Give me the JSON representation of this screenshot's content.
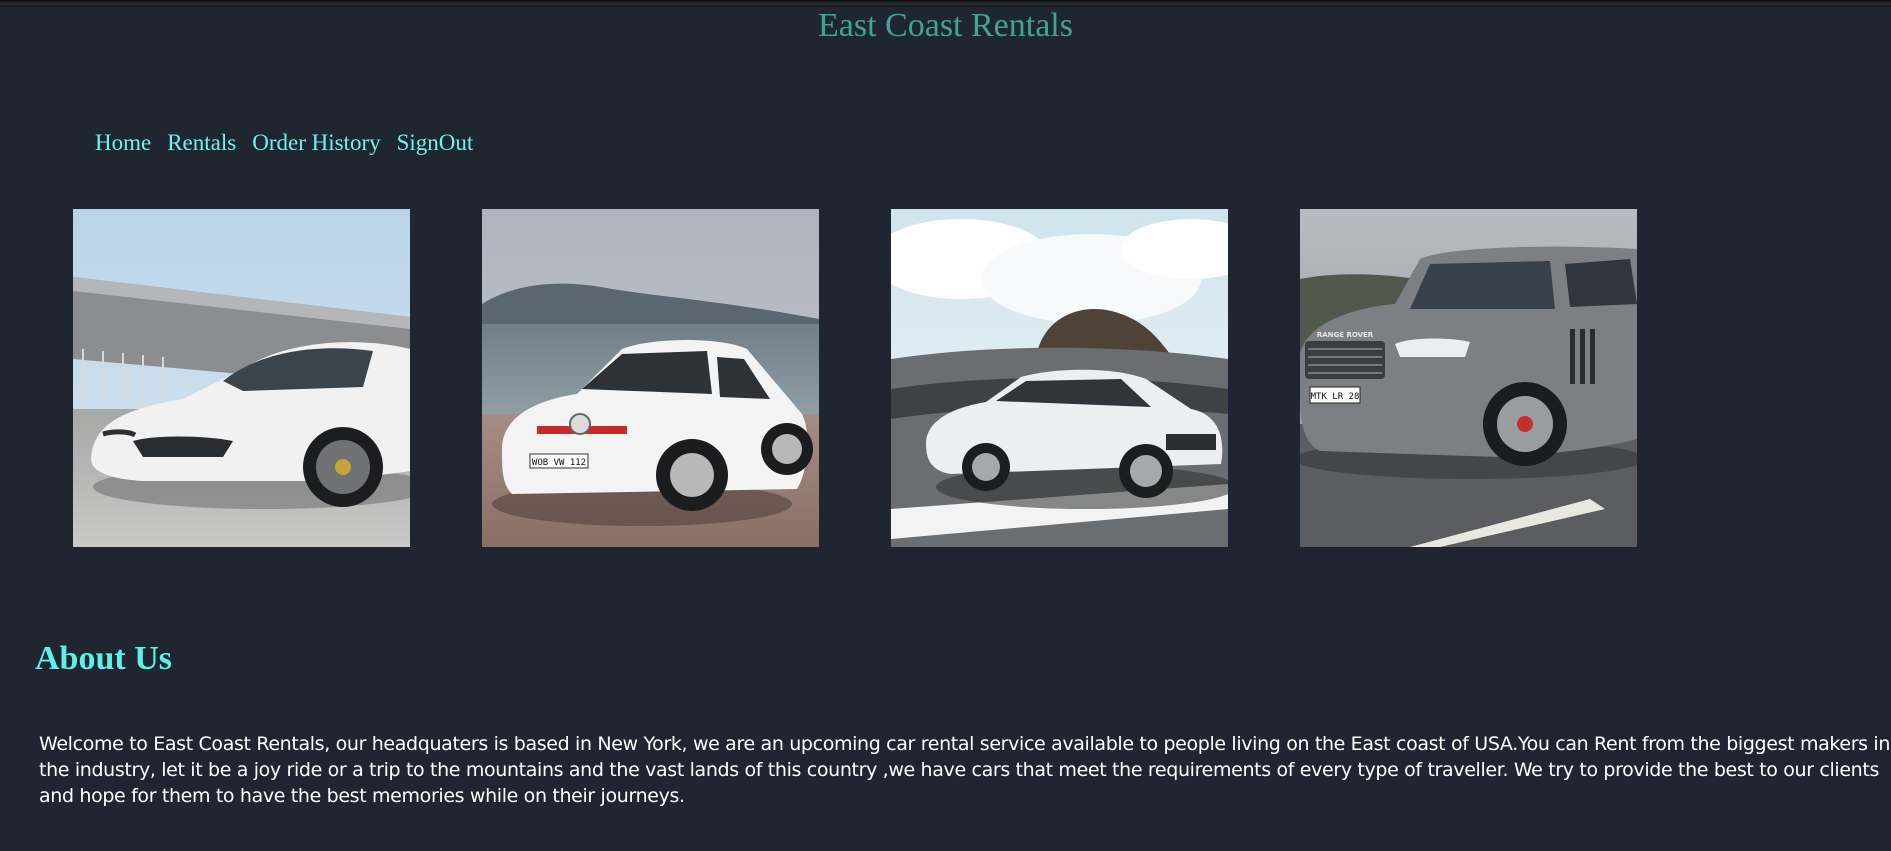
{
  "header": {
    "title": "East Coast Rentals"
  },
  "nav": {
    "items": [
      {
        "label": "Home"
      },
      {
        "label": "Rentals"
      },
      {
        "label": "Order History"
      },
      {
        "label": "SignOut"
      }
    ]
  },
  "gallery": {
    "photos": [
      {
        "subject": "white sports car",
        "plate": ""
      },
      {
        "subject": "white hatchback",
        "plate": "WOB VW 112"
      },
      {
        "subject": "white sedan",
        "plate": ""
      },
      {
        "subject": "grey suv",
        "plate": "MTK LR 28",
        "badge": "RANGE ROVER"
      }
    ]
  },
  "about": {
    "heading": "About Us",
    "body": "Welcome to East Coast Rentals, our headquaters is based in New York, we are an upcoming car rental service available to people living on the East coast of USA.You can Rent from the biggest makers in the industry, let it be a joy ride or a trip to the mountains and the vast lands of this country ,we have cars that meet the requirements of every type of traveller. We try to provide the best to our clients and hope for them to have the best memories while on their journeys."
  },
  "colors": {
    "background": "#1f2631",
    "title": "#3fa39a",
    "nav_link": "#6ff2ee",
    "heading": "#5ff0e8",
    "body_text": "#ffffff"
  }
}
